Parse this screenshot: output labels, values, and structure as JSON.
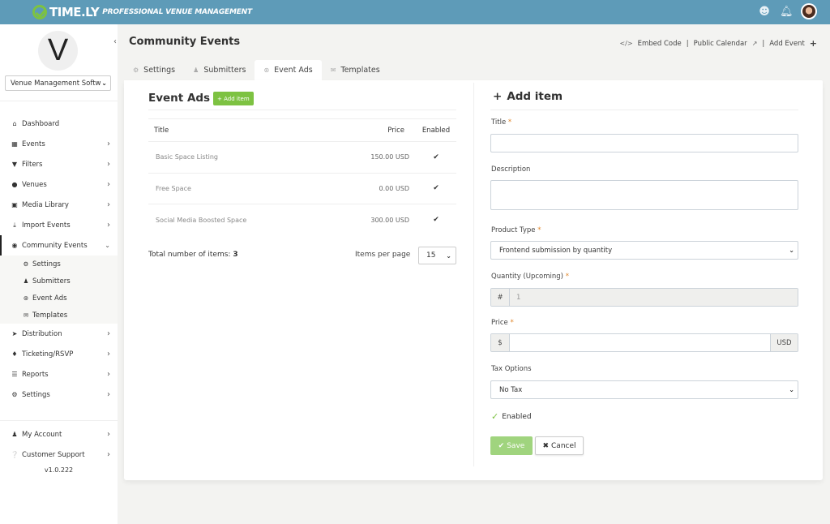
{
  "topbar": {
    "logo_text": "TIME.LY",
    "logo_subtitle": "PROFESSIONAL VENUE MANAGEMENT",
    "icons": [
      "support-agent-icon",
      "bell-icon",
      "user-avatar"
    ]
  },
  "sidebar": {
    "brand_initial": "V",
    "org_select": "Venue Management Softw",
    "items": [
      {
        "label": "Dashboard",
        "icon": "home-icon",
        "has_arrow": false
      },
      {
        "label": "Events",
        "icon": "calendar-icon",
        "has_arrow": true
      },
      {
        "label": "Filters",
        "icon": "filter-icon",
        "has_arrow": true
      },
      {
        "label": "Venues",
        "icon": "map-marker-icon",
        "has_arrow": true
      },
      {
        "label": "Media Library",
        "icon": "image-icon",
        "has_arrow": true
      },
      {
        "label": "Import Events",
        "icon": "download-icon",
        "has_arrow": true
      },
      {
        "label": "Community Events",
        "icon": "globe-icon",
        "has_arrow": true,
        "expanded": true
      }
    ],
    "sub_items": [
      {
        "label": "Settings",
        "icon": "cogs-icon"
      },
      {
        "label": "Submitters",
        "icon": "users-icon"
      },
      {
        "label": "Event Ads",
        "icon": "cart-icon"
      },
      {
        "label": "Templates",
        "icon": "envelope-icon"
      }
    ],
    "items_after": [
      {
        "label": "Distribution",
        "icon": "paper-plane-icon"
      },
      {
        "label": "Ticketing/RSVP",
        "icon": "tags-icon"
      },
      {
        "label": "Reports",
        "icon": "list-icon"
      },
      {
        "label": "Settings",
        "icon": "cogs-icon"
      }
    ],
    "footer_items": [
      {
        "label": "My Account",
        "icon": "user-icon"
      },
      {
        "label": "Customer Support",
        "icon": "question-circle-icon"
      }
    ],
    "version": "v1.0.222"
  },
  "header": {
    "title": "Community Events",
    "links": {
      "embed_code": "Embed Code",
      "public_calendar": "Public Calendar",
      "add_event": "Add Event",
      "separator": "|"
    }
  },
  "tabs": [
    {
      "label": "Settings",
      "icon": "gear-icon",
      "active": false
    },
    {
      "label": "Submitters",
      "icon": "users-icon",
      "active": false
    },
    {
      "label": "Event Ads",
      "icon": "cart-icon",
      "active": true
    },
    {
      "label": "Templates",
      "icon": "envelope-icon",
      "active": false
    }
  ],
  "event_ads": {
    "title": "Event Ads",
    "add_button": "+ Add item",
    "columns": {
      "title": "Title",
      "price": "Price",
      "enabled": "Enabled"
    },
    "rows": [
      {
        "title": "Basic Space Listing",
        "price": "150.00 USD",
        "enabled": "✔"
      },
      {
        "title": "Free Space",
        "price": "0.00 USD",
        "enabled": "✔"
      },
      {
        "title": "Social Media Boosted Space",
        "price": "300.00 USD",
        "enabled": "✔"
      }
    ],
    "total_label": "Total number of items:",
    "total_value": "3",
    "items_per_page_label": "Items per page",
    "items_per_page_value": "15"
  },
  "form": {
    "title": "Add item",
    "title_label": "Title",
    "title_value": "",
    "description_label": "Description",
    "description_value": "",
    "product_type_label": "Product Type",
    "product_type_value": "Frontend submission by quantity",
    "quantity_label": "Quantity (Upcoming)",
    "quantity_addon": "#",
    "quantity_value": "1",
    "price_label": "Price",
    "price_prefix": "$",
    "price_value": "",
    "price_suffix": "USD",
    "tax_label": "Tax Options",
    "tax_value": "No Tax",
    "enabled_label": "Enabled",
    "required_mark": "*",
    "save_label": "Save",
    "cancel_label": "Cancel"
  },
  "colors": {
    "topbar": "#5e9bb8",
    "accent_green": "#7dc242",
    "save_green": "#a0d47e",
    "required": "#e0862a"
  }
}
